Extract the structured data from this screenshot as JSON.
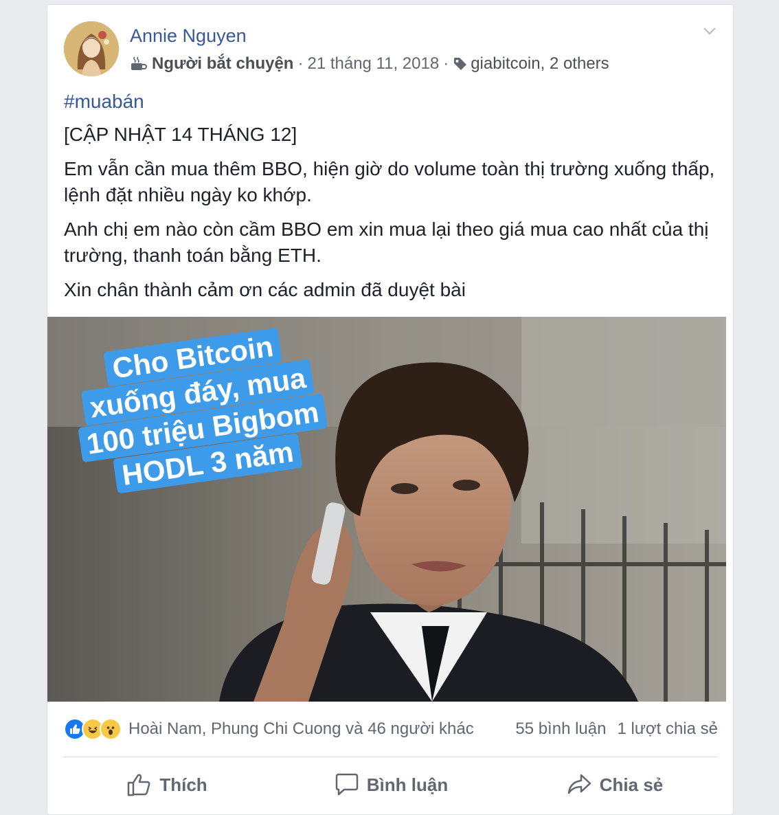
{
  "post": {
    "author": "Annie Nguyen",
    "badge_icon": "coffee-cup-icon",
    "badge": "Người bắt chuyện",
    "separator": "·",
    "date": "21 tháng 11, 2018",
    "tag_icon": "tag-icon",
    "tag_primary": "giabitcoin",
    "tag_rest": ", 2 others",
    "hashtag": "#muabán",
    "paragraphs": [
      "[CẬP NHẬT 14 THÁNG 12]",
      "Em vẫn cần mua thêm BBO, hiện giờ do volume toàn thị trường xuống thấp, lệnh đặt nhiều ngày ko khớp.",
      "Anh chị em nào còn cầm BBO em xin mua lại theo giá mua cao nhất của thị trường, thanh toán bằng ETH.",
      "Xin chân thành cảm ơn các admin đã duyệt bài"
    ],
    "image_caption": "Cho Bitcoin xuống đáy, mua 100 triệu Bigbom HODL 3 năm"
  },
  "engagement": {
    "reaction_icons": [
      "like-icon",
      "haha-icon",
      "wow-icon"
    ],
    "reactors": "Hoài Nam, Phung Chi Cuong và 46 người khác",
    "comments": "55 bình luận",
    "shares": "1 lượt chia sẻ"
  },
  "actions": {
    "like": "Thích",
    "comment": "Bình luận",
    "share": "Chia sẻ"
  },
  "colors": {
    "link_blue": "#365899",
    "caption_bg": "#3d9be9",
    "like_blue": "#1877f2",
    "meta_gray": "#606770"
  }
}
